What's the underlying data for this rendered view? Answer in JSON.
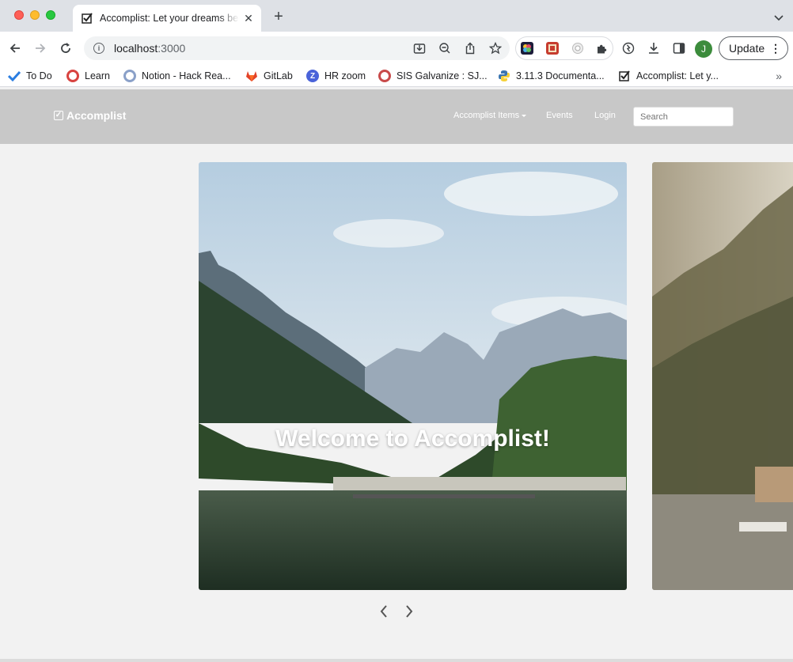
{
  "browser": {
    "tab_title": "Accomplist: Let your dreams be",
    "url_host": "localhost",
    "url_port": ":3000",
    "update_label": "Update",
    "avatar_letter": "J",
    "bookmarks": [
      {
        "label": "To Do",
        "icon": "todo-check-icon"
      },
      {
        "label": "Learn",
        "icon": "learn-ring-icon"
      },
      {
        "label": "Notion - Hack Rea...",
        "icon": "notion-ring-icon"
      },
      {
        "label": "GitLab",
        "icon": "gitlab-fox-icon"
      },
      {
        "label": "HR zoom",
        "icon": "zoom-z-icon"
      },
      {
        "label": "SIS Galvanize : SJ...",
        "icon": "sis-ring-icon"
      },
      {
        "label": "3.11.3 Documenta...",
        "icon": "python-icon"
      },
      {
        "label": "Accomplist: Let y...",
        "icon": "accomplist-check-icon"
      }
    ]
  },
  "site": {
    "brand": "Accomplist",
    "nav": {
      "items_label": "Accomplist Items",
      "events_label": "Events",
      "login_label": "Login",
      "search_placeholder": "Search"
    }
  },
  "carousel": {
    "slides": [
      {
        "title": "Welcome to Accomplist!",
        "scene": "mountain-lake-icon"
      },
      {
        "title": "",
        "scene": "lakeside-village-icon"
      }
    ]
  }
}
